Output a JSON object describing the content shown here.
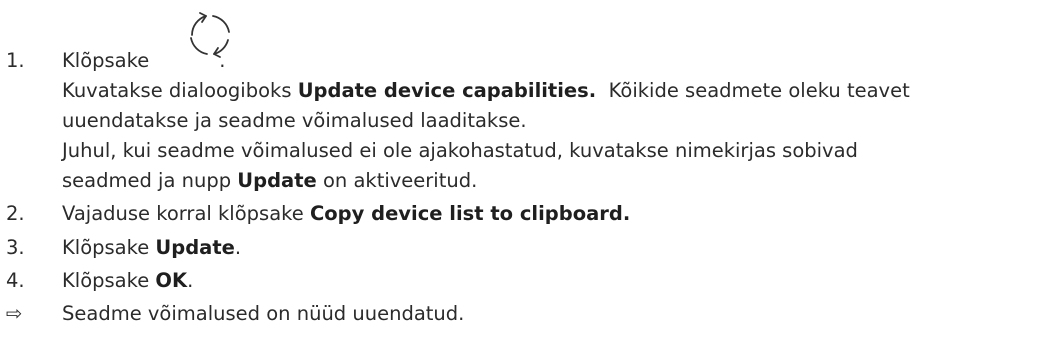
{
  "steps": [
    {
      "number": "1.",
      "before": "Klõpsake",
      "after": ".",
      "icon": "refresh-icon",
      "detail1_prefix": "Kuvatakse dialoogiboks ",
      "detail1_bold": "Update device capabilities.",
      "detail1_suffix": "  Kõikide seadmete oleku teavet",
      "detail2": "uuendatakse ja seadme võimalused laaditakse.",
      "detail3": "Juhul, kui seadme võimalused ei ole ajakohastatud, kuvatakse nimekirjas sobivad",
      "detail4_prefix": "seadmed ja nupp ",
      "detail4_bold": "Update",
      "detail4_suffix": " on aktiveeritud."
    },
    {
      "number": "2.",
      "prefix": "Vajaduse korral klõpsake ",
      "bold": "Copy device list to clipboard."
    },
    {
      "number": "3.",
      "prefix": "Klõpsake ",
      "bold": "Update",
      "suffix": "."
    },
    {
      "number": "4.",
      "prefix": "Klõpsake ",
      "bold": "OK",
      "suffix": "."
    }
  ],
  "result": {
    "symbol": "⇨",
    "text": "Seadme võimalused on nüüd uuendatud."
  },
  "colors": {
    "text": "#2b2b2b",
    "icon": "#333333"
  }
}
